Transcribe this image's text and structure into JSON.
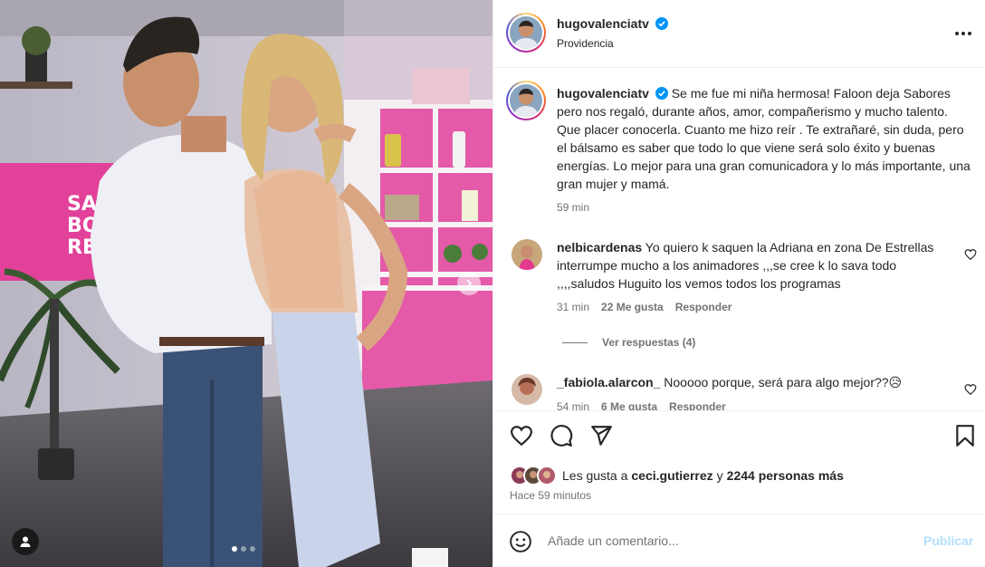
{
  "post": {
    "author": "hugovalenciatv",
    "location": "Providencia",
    "caption": "Se me fue mi niña hermosa! Faloon deja Sabores pero nos regaló, durante años, amor, compañerismo y mucho talento. Que placer conocerla. Cuanto me hizo reír . Te extrañaré, sin duda, pero el bálsamo es saber que todo lo que viene será solo éxito y buenas energías. Lo mejor para una gran comunicadora y lo más importante, una gran mujer y mamá.",
    "caption_time": "59 min",
    "photo_sign_text": "SA\nBO\nRE",
    "carousel": {
      "total": 3,
      "active": 1
    }
  },
  "comments": [
    {
      "user": "nelbicardenas",
      "text": "Yo quiero k saquen la Adriana en zona De Estrellas interrumpe mucho a los animadores ,,,se cree k lo sava todo ,,,,saludos Huguito los vemos todos los programas",
      "time": "31 min",
      "likes": "22 Me gusta",
      "reply": "Responder",
      "view_replies": "Ver respuestas (4)"
    },
    {
      "user": "_fabiola.alarcon_",
      "text": "Nooooo porque, será para algo mejor??😥",
      "time": "54 min",
      "likes": "6 Me gusta",
      "reply": "Responder"
    }
  ],
  "likes": {
    "prefix": "Les gusta a",
    "user": "ceci.gutierrez",
    "joiner": "y",
    "others": "2244 personas más"
  },
  "timestamp": "Hace 59 minutos",
  "compose": {
    "placeholder": "Añade un comentario...",
    "post_label": "Publicar"
  },
  "colors": {
    "verified": "#0095f6",
    "post_button_disabled": "#b2dffc",
    "set_pink": "#e2419a"
  },
  "icons": {
    "like": "heart-icon",
    "comment": "comment-icon",
    "share": "send-icon",
    "save": "bookmark-icon",
    "emoji": "emoji-icon",
    "more": "more-icon",
    "next": "chevron-right-icon",
    "tag": "user-tag-icon"
  }
}
